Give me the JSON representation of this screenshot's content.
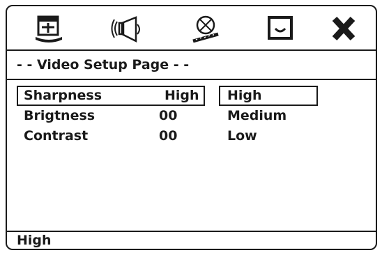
{
  "menu": {
    "icons": [
      {
        "name": "general-setup-icon",
        "active": false
      },
      {
        "name": "audio-setup-icon",
        "active": false
      },
      {
        "name": "video-setup-icon",
        "active": true
      },
      {
        "name": "preference-setup-icon",
        "active": false
      },
      {
        "name": "exit-setup-icon",
        "active": false
      }
    ]
  },
  "page": {
    "title": "- - Video Setup Page - -"
  },
  "settings": [
    {
      "label": "Sharpness",
      "value": "High"
    },
    {
      "label": "Brigtness",
      "value": "00"
    },
    {
      "label": "Contrast",
      "value": "00"
    }
  ],
  "options": [
    "High",
    "Medium",
    "Low"
  ],
  "status": {
    "text": "High"
  },
  "colors": {
    "line": "#1a1a1a",
    "background": "#ffffff"
  }
}
